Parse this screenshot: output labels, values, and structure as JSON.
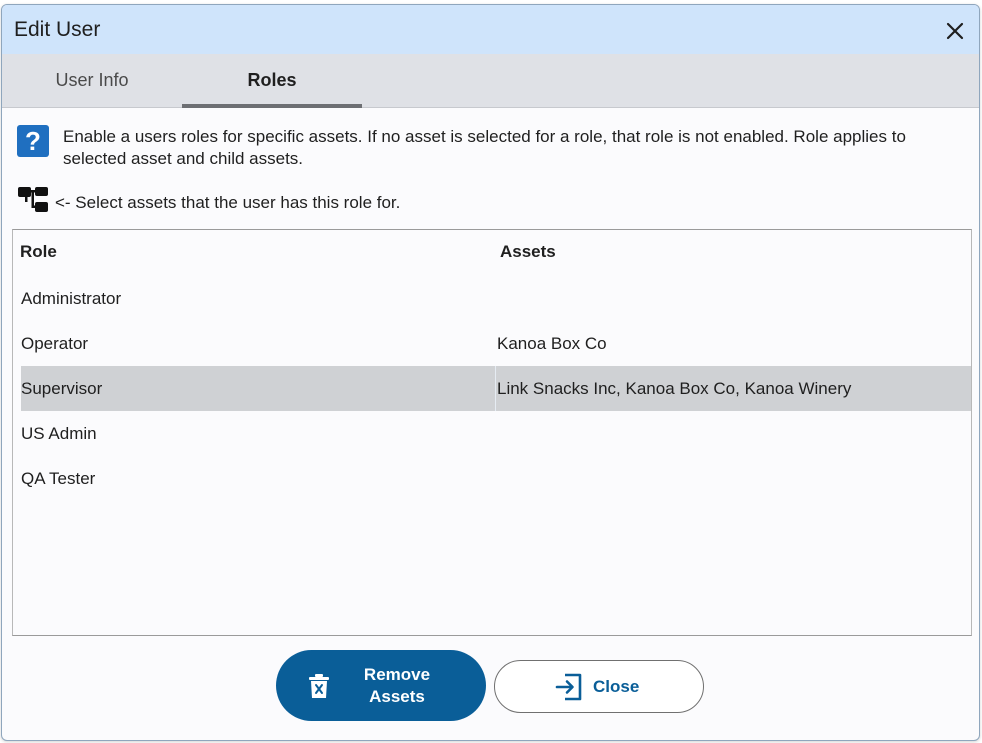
{
  "window": {
    "title": "Edit User"
  },
  "tabs": [
    {
      "label": "User Info",
      "active": false
    },
    {
      "label": "Roles",
      "active": true
    }
  ],
  "info": {
    "icon": "help-icon",
    "text": "Enable a users roles for specific assets. If no asset is selected for a role, that role is not enabled. Role applies to selected asset and child assets."
  },
  "hint": {
    "icon": "asset-tree-icon",
    "text": "<- Select assets that the user has this role for."
  },
  "table": {
    "headers": {
      "role": "Role",
      "assets": "Assets"
    },
    "rows": [
      {
        "role": "Administrator",
        "assets": ""
      },
      {
        "role": "Operator",
        "assets": "Kanoa Box Co"
      },
      {
        "role": "Supervisor",
        "assets": "Link Snacks Inc, Kanoa Box Co, Kanoa Winery",
        "selected": true
      },
      {
        "role": "US Admin",
        "assets": ""
      },
      {
        "role": "QA Tester",
        "assets": ""
      }
    ]
  },
  "buttons": {
    "remove_line1": "Remove",
    "remove_line2": "Assets",
    "close": "Close"
  },
  "colors": {
    "titlebar": "#cfe4fb",
    "accent": "#0a5e98",
    "selected_row": "#cfd1d4"
  }
}
